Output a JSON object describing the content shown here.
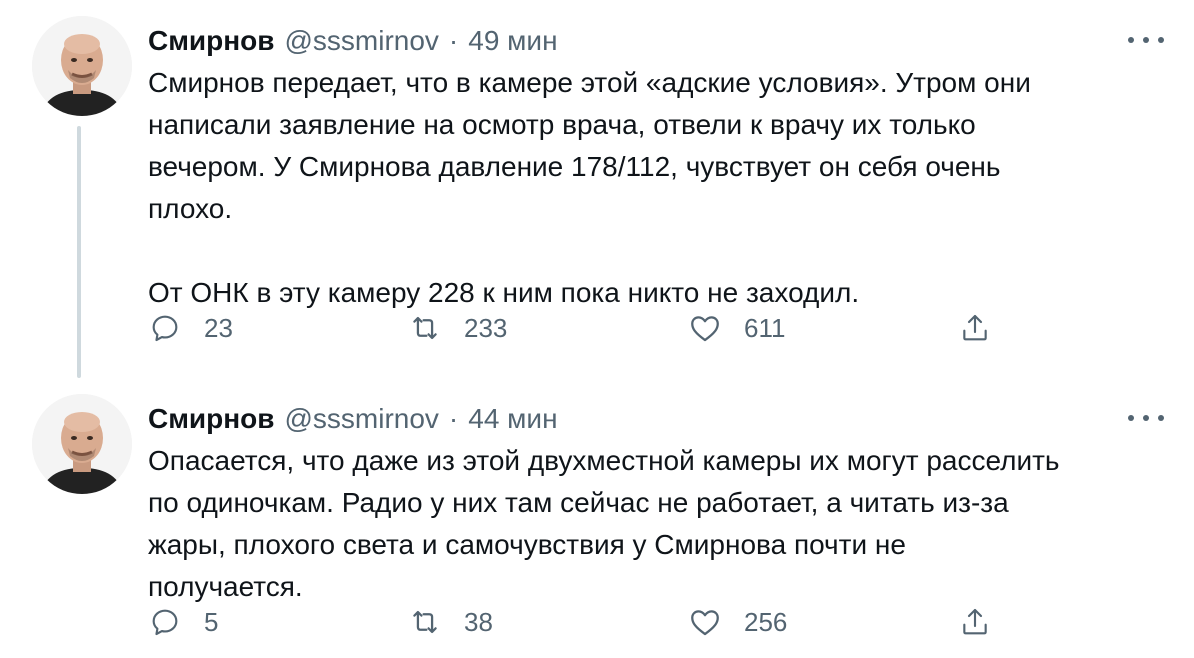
{
  "thread": [
    {
      "name": "Смирнов",
      "handle": "@sssmirnov",
      "separator": "·",
      "time": "49 мин",
      "text": "Смирнов передает, что в камере этой «адские условия». Утром они\nнаписали заявление на осмотр врача, отвели к врачу их только\nвечером. У Смирнова давление 178/112, чувствует он себя очень\nплохо.\n\nОт ОНК в эту камеру 228 к ним пока никто не заходил.",
      "replies": "23",
      "retweets": "233",
      "likes": "611"
    },
    {
      "name": "Смирнов",
      "handle": "@sssmirnov",
      "separator": "·",
      "time": "44 мин",
      "text": "Опасается, что даже из этой двухместной камеры их могут расселить\nпо одиночкам. Радио у них там сейчас не работает, а читать из-за\nжары, плохого света и самочувствия у Смирнова почти не\nполучается.",
      "replies": "5",
      "retweets": "38",
      "likes": "256"
    }
  ],
  "icons": {
    "reply": "reply-icon",
    "retweet": "retweet-icon",
    "like": "heart-icon",
    "share": "share-icon",
    "more": "more-icon"
  },
  "colors": {
    "text": "#0f1419",
    "secondary": "#536471",
    "thread_line": "#cfd9de"
  }
}
